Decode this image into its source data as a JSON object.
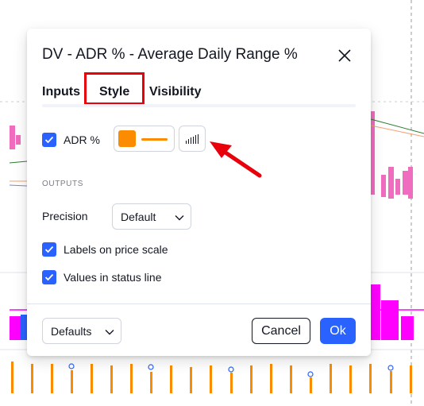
{
  "dialog": {
    "title": "DV - ADR % - Average Daily Range %",
    "tabs": {
      "inputs": "Inputs",
      "style": "Style",
      "visibility": "Visibility"
    },
    "style_plot": {
      "label": "ADR %",
      "checked": true,
      "color": "#fb8c00"
    },
    "outputs": {
      "section_label": "OUTPUTS",
      "precision_label": "Precision",
      "precision_value": "Default",
      "labels_on_price_scale": "Labels on price scale",
      "values_in_status_line": "Values in status line"
    },
    "footer": {
      "defaults": "Defaults",
      "cancel": "Cancel",
      "ok": "Ok"
    }
  },
  "colors": {
    "accent_blue": "#2962ff",
    "highlight_red": "#e8000b",
    "orange": "#fb8c00",
    "magenta": "#ff00ff",
    "pink": "#f06cbf"
  },
  "icons": [
    "close-icon",
    "check-icon",
    "chevron-down-icon",
    "plot-style-columns-icon",
    "red-arrow-annotation"
  ]
}
